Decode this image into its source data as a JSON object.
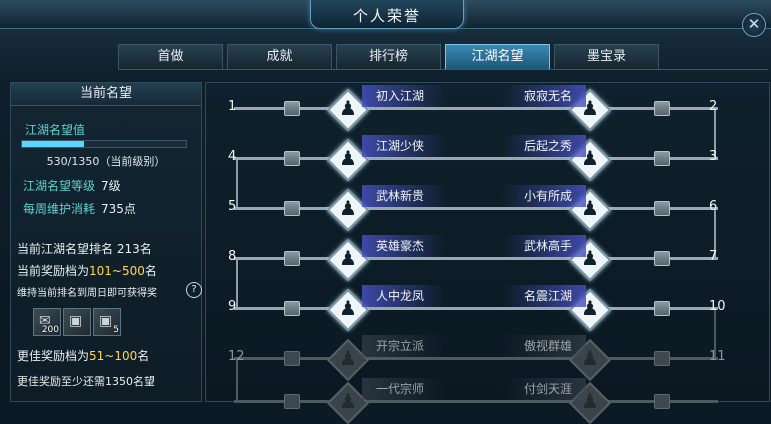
{
  "window": {
    "title": "个人荣誉",
    "close_label": "✕"
  },
  "tabs": [
    {
      "label": "首做",
      "active": false
    },
    {
      "label": "成就",
      "active": false
    },
    {
      "label": "排行榜",
      "active": false
    },
    {
      "label": "江湖名望",
      "active": true
    },
    {
      "label": "墨宝录",
      "active": false
    }
  ],
  "left": {
    "header": "当前名望",
    "rep_label": "江湖名望值",
    "rep_progress": 0.38,
    "rep_value": "530/1350（当前级别）",
    "level_label": "江湖名望等级",
    "level_value": "7级",
    "weekly_label": "每周维护消耗",
    "weekly_value": "735点",
    "rank_label": "当前江湖名望排名",
    "rank_value": "213名",
    "tier_prefix": "当前奖励档为",
    "tier_value": "101~500",
    "tier_suffix": "名",
    "note": "维持当前排名到周日即可获得奖",
    "help": "?",
    "rewards": [
      {
        "icon": "scroll-icon",
        "glyph": "✉",
        "count": "200"
      },
      {
        "icon": "chest-icon",
        "glyph": "▣",
        "count": ""
      },
      {
        "icon": "chest-icon",
        "glyph": "▣",
        "count": "5"
      }
    ],
    "better_prefix": "更佳奖励档为",
    "better_value": "51~100",
    "better_suffix": "名",
    "need_text": "更佳奖励至少还需1350名望"
  },
  "levels": [
    {
      "num": "1",
      "name": "初入江湖",
      "side": "left",
      "active": true
    },
    {
      "num": "2",
      "name": "寂寂无名",
      "side": "right",
      "active": true
    },
    {
      "num": "3",
      "name": "后起之秀",
      "side": "right",
      "active": true
    },
    {
      "num": "4",
      "name": "江湖少侠",
      "side": "left",
      "active": true
    },
    {
      "num": "5",
      "name": "武林新贵",
      "side": "left",
      "active": true
    },
    {
      "num": "6",
      "name": "小有所成",
      "side": "right",
      "active": true
    },
    {
      "num": "7",
      "name": "武林高手",
      "side": "right",
      "active": true
    },
    {
      "num": "8",
      "name": "英雄豪杰",
      "side": "left",
      "active": true
    },
    {
      "num": "9",
      "name": "人中龙凤",
      "side": "left",
      "active": true
    },
    {
      "num": "10",
      "name": "名震江湖",
      "side": "right",
      "active": true
    },
    {
      "num": "11",
      "name": "傲视群雄",
      "side": "right",
      "active": false
    },
    {
      "num": "12",
      "name": "开宗立派",
      "side": "left",
      "active": false
    },
    {
      "num": "",
      "name": "一代宗师",
      "side": "left",
      "active": false
    },
    {
      "num": "",
      "name": "付剑天涯",
      "side": "right",
      "active": false
    }
  ]
}
